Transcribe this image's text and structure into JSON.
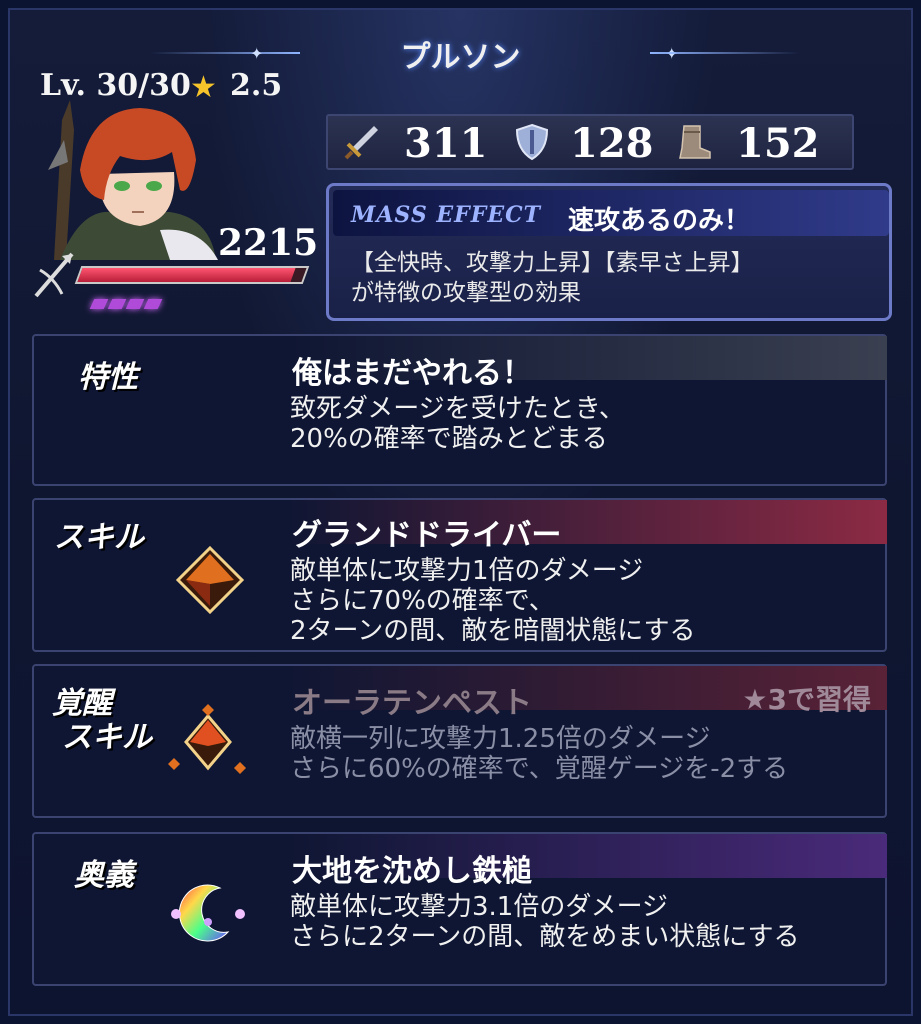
{
  "character": {
    "name": "プルソン",
    "level": "Lv. 30/30",
    "rarity": "2.5",
    "hp": "2215",
    "hp_fraction": 0.95,
    "charges": 4
  },
  "stats": {
    "attack": "311",
    "defense": "128",
    "speed": "152"
  },
  "mass_effect": {
    "label": "MASS EFFECT",
    "name": "速攻あるのみ！",
    "desc1": "【全快時、攻撃力上昇】【素早さ上昇】",
    "desc2": "が特徴の攻撃型の効果"
  },
  "trait": {
    "label": "特性",
    "name": "俺はまだやれる！",
    "desc1": "致死ダメージを受けたとき、",
    "desc2": "20%の確率で踏みとどまる"
  },
  "skill": {
    "label": "スキル",
    "name": "グランドドライバー",
    "desc1": "敵単体に攻撃力1倍のダメージ",
    "desc2": "さらに70%の確率で、",
    "desc3": "2ターンの間、敵を暗闇状態にする"
  },
  "awaken": {
    "label1": "覚醒",
    "label2": "スキル",
    "name": "オーラテンペスト",
    "requirement": "★3で習得",
    "desc1": "敵横一列に攻撃力1.25倍のダメージ",
    "desc2": "さらに60%の確率で、覚醒ゲージを-2する"
  },
  "ougi": {
    "label": "奥義",
    "name": "大地を沈めし鉄槌",
    "desc1": "敵単体に攻撃力3.1倍のダメージ",
    "desc2": "さらに2ターンの間、敵をめまい状態にする"
  },
  "colors": {
    "skill_bar": "#8c2a44",
    "ougi_bar": "#4a2a7a",
    "trait_bar": "#3a4050",
    "hp_fill": "#e0304e",
    "star": "#f6c42a"
  }
}
